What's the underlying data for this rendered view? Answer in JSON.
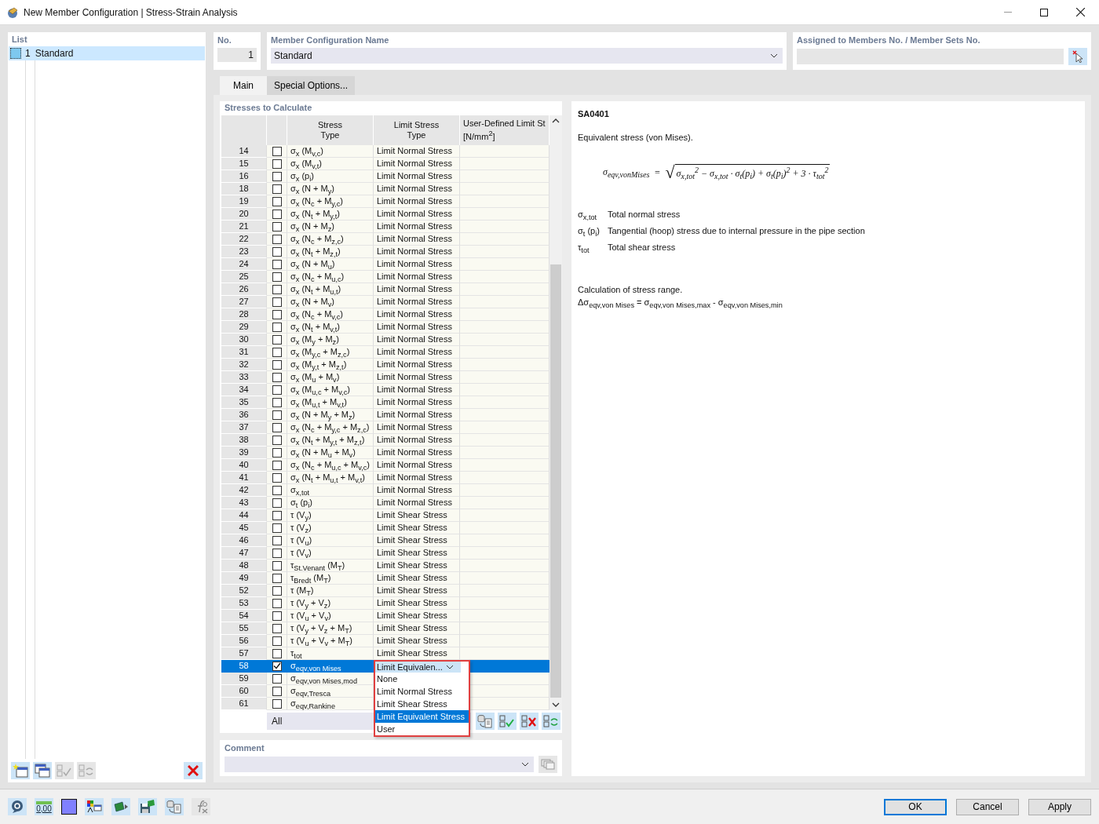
{
  "window": {
    "title": "New Member Configuration | Stress-Strain Analysis"
  },
  "list": {
    "heading": "List",
    "items": [
      {
        "no": "1",
        "name": "Standard",
        "selected": true
      }
    ]
  },
  "number": {
    "label": "No.",
    "value": "1"
  },
  "name": {
    "label": "Member Configuration Name",
    "value": "Standard"
  },
  "assigned": {
    "label": "Assigned to Members No. / Member Sets No."
  },
  "tabs": [
    {
      "label": "Main",
      "selected": true
    },
    {
      "label": "Special Options...",
      "selected": false
    }
  ],
  "stresses": {
    "heading": "Stresses to Calculate",
    "columns": [
      [
        "Stress",
        "Type"
      ],
      [
        "Limit Stress",
        "Type"
      ],
      [
        "User-Defined Limit St",
        "[N/mm$^{2}$]"
      ]
    ],
    "rows": [
      {
        "no": "14",
        "checked": false,
        "selected": false,
        "stress": "σ$_{x}$ (M$_{v,c}$)",
        "limit": "Limit Normal Stress"
      },
      {
        "no": "15",
        "checked": false,
        "selected": false,
        "stress": "σ$_{x}$ (M$_{v,t}$)",
        "limit": "Limit Normal Stress"
      },
      {
        "no": "16",
        "checked": false,
        "selected": false,
        "stress": "σ$_{x}$ (p$_{i}$)",
        "limit": "Limit Normal Stress"
      },
      {
        "no": "18",
        "checked": false,
        "selected": false,
        "stress": "σ$_{x}$ (N + M$_{y}$)",
        "limit": "Limit Normal Stress"
      },
      {
        "no": "19",
        "checked": false,
        "selected": false,
        "stress": "σ$_{x}$ (N$_{c}$ + M$_{y,c}$)",
        "limit": "Limit Normal Stress"
      },
      {
        "no": "20",
        "checked": false,
        "selected": false,
        "stress": "σ$_{x}$ (N$_{t}$ + M$_{y,t}$)",
        "limit": "Limit Normal Stress"
      },
      {
        "no": "21",
        "checked": false,
        "selected": false,
        "stress": "σ$_{x}$ (N + M$_{z}$)",
        "limit": "Limit Normal Stress"
      },
      {
        "no": "22",
        "checked": false,
        "selected": false,
        "stress": "σ$_{x}$ (N$_{c}$ + M$_{z,c}$)",
        "limit": "Limit Normal Stress"
      },
      {
        "no": "23",
        "checked": false,
        "selected": false,
        "stress": "σ$_{x}$ (N$_{t}$ + M$_{z,t}$)",
        "limit": "Limit Normal Stress"
      },
      {
        "no": "24",
        "checked": false,
        "selected": false,
        "stress": "σ$_{x}$ (N + M$_{u}$)",
        "limit": "Limit Normal Stress"
      },
      {
        "no": "25",
        "checked": false,
        "selected": false,
        "stress": "σ$_{x}$ (N$_{c}$ + M$_{u,c}$)",
        "limit": "Limit Normal Stress"
      },
      {
        "no": "26",
        "checked": false,
        "selected": false,
        "stress": "σ$_{x}$ (N$_{t}$ + M$_{u,t}$)",
        "limit": "Limit Normal Stress"
      },
      {
        "no": "27",
        "checked": false,
        "selected": false,
        "stress": "σ$_{x}$ (N + M$_{v}$)",
        "limit": "Limit Normal Stress"
      },
      {
        "no": "28",
        "checked": false,
        "selected": false,
        "stress": "σ$_{x}$ (N$_{c}$ + M$_{v,c}$)",
        "limit": "Limit Normal Stress"
      },
      {
        "no": "29",
        "checked": false,
        "selected": false,
        "stress": "σ$_{x}$ (N$_{t}$ + M$_{v,t}$)",
        "limit": "Limit Normal Stress"
      },
      {
        "no": "30",
        "checked": false,
        "selected": false,
        "stress": "σ$_{x}$ (M$_{y}$ + M$_{z}$)",
        "limit": "Limit Normal Stress"
      },
      {
        "no": "31",
        "checked": false,
        "selected": false,
        "stress": "σ$_{x}$ (M$_{y,c}$ + M$_{z,c}$)",
        "limit": "Limit Normal Stress"
      },
      {
        "no": "32",
        "checked": false,
        "selected": false,
        "stress": "σ$_{x}$ (M$_{y,t}$ + M$_{z,t}$)",
        "limit": "Limit Normal Stress"
      },
      {
        "no": "33",
        "checked": false,
        "selected": false,
        "stress": "σ$_{x}$ (M$_{u}$ + M$_{v}$)",
        "limit": "Limit Normal Stress"
      },
      {
        "no": "34",
        "checked": false,
        "selected": false,
        "stress": "σ$_{x}$ (M$_{u,c}$ + M$_{v,c}$)",
        "limit": "Limit Normal Stress"
      },
      {
        "no": "35",
        "checked": false,
        "selected": false,
        "stress": "σ$_{x}$ (M$_{u,t}$ + M$_{v,t}$)",
        "limit": "Limit Normal Stress"
      },
      {
        "no": "36",
        "checked": false,
        "selected": false,
        "stress": "σ$_{x}$ (N + M$_{y}$ + M$_{z}$)",
        "limit": "Limit Normal Stress"
      },
      {
        "no": "37",
        "checked": false,
        "selected": false,
        "stress": "σ$_{x}$ (N$_{c}$ + M$_{y,c}$ + M$_{z,c}$)",
        "limit": "Limit Normal Stress"
      },
      {
        "no": "38",
        "checked": false,
        "selected": false,
        "stress": "σ$_{x}$ (N$_{t}$ + M$_{y,t}$ + M$_{z,t}$)",
        "limit": "Limit Normal Stress"
      },
      {
        "no": "39",
        "checked": false,
        "selected": false,
        "stress": "σ$_{x}$ (N + M$_{u}$ + M$_{v}$)",
        "limit": "Limit Normal Stress"
      },
      {
        "no": "40",
        "checked": false,
        "selected": false,
        "stress": "σ$_{x}$ (N$_{c}$ + M$_{u,c}$ + M$_{v,c}$)",
        "limit": "Limit Normal Stress"
      },
      {
        "no": "41",
        "checked": false,
        "selected": false,
        "stress": "σ$_{x}$ (N$_{t}$ + M$_{u,t}$ + M$_{v,t}$)",
        "limit": "Limit Normal Stress"
      },
      {
        "no": "42",
        "checked": false,
        "selected": false,
        "stress": "σ$_{x,tot}$",
        "limit": "Limit Normal Stress"
      },
      {
        "no": "43",
        "checked": false,
        "selected": false,
        "stress": "σ$_{t}$ (p$_{i}$)",
        "limit": "Limit Normal Stress"
      },
      {
        "no": "44",
        "checked": false,
        "selected": false,
        "stress": "τ (V$_{y}$)",
        "limit": "Limit Shear Stress"
      },
      {
        "no": "45",
        "checked": false,
        "selected": false,
        "stress": "τ (V$_{z}$)",
        "limit": "Limit Shear Stress"
      },
      {
        "no": "46",
        "checked": false,
        "selected": false,
        "stress": "τ (V$_{u}$)",
        "limit": "Limit Shear Stress"
      },
      {
        "no": "47",
        "checked": false,
        "selected": false,
        "stress": "τ (V$_{v}$)",
        "limit": "Limit Shear Stress"
      },
      {
        "no": "48",
        "checked": false,
        "selected": false,
        "stress": "τ$_{St.Venant}$ (M$_{T}$)",
        "limit": "Limit Shear Stress"
      },
      {
        "no": "49",
        "checked": false,
        "selected": false,
        "stress": "τ$_{Bredt}$ (M$_{T}$)",
        "limit": "Limit Shear Stress"
      },
      {
        "no": "52",
        "checked": false,
        "selected": false,
        "stress": "τ (M$_{T}$)",
        "limit": "Limit Shear Stress"
      },
      {
        "no": "53",
        "checked": false,
        "selected": false,
        "stress": "τ (V$_{y}$ + V$_{z}$)",
        "limit": "Limit Shear Stress"
      },
      {
        "no": "54",
        "checked": false,
        "selected": false,
        "stress": "τ (V$_{u}$ + V$_{v}$)",
        "limit": "Limit Shear Stress"
      },
      {
        "no": "55",
        "checked": false,
        "selected": false,
        "stress": "τ (V$_{y}$ + V$_{z}$ + M$_{T}$)",
        "limit": "Limit Shear Stress"
      },
      {
        "no": "56",
        "checked": false,
        "selected": false,
        "stress": "τ (V$_{u}$ + V$_{v}$ + M$_{T}$)",
        "limit": "Limit Shear Stress"
      },
      {
        "no": "57",
        "checked": false,
        "selected": false,
        "stress": "τ$_{tot}$",
        "limit": "Limit Shear Stress"
      },
      {
        "no": "58",
        "checked": true,
        "selected": true,
        "stress": "σ$_{eqv,von Mises}$",
        "limit": "Limit Equivalen..."
      },
      {
        "no": "59",
        "checked": false,
        "selected": false,
        "stress": "σ$_{eqv,von Mises,mod}$"
      },
      {
        "no": "60",
        "checked": false,
        "selected": false,
        "stress": "σ$_{eqv,Tresca}$"
      },
      {
        "no": "61",
        "checked": false,
        "selected": false,
        "stress": "σ$_{eqv,Rankine}$"
      }
    ],
    "options": [
      {
        "label": "None",
        "selected": false
      },
      {
        "label": "Limit Normal Stress",
        "selected": false
      },
      {
        "label": "Limit Shear Stress",
        "selected": false
      },
      {
        "label": "Limit Equivalent Stress",
        "selected": true
      },
      {
        "label": "User",
        "selected": false
      }
    ],
    "filter": "All"
  },
  "comment": {
    "label": "Comment"
  },
  "description": {
    "code": "SA0401",
    "text": "Equivalent stress (von Mises).",
    "formula": {
      "lhs": "σ$_{eqv,vonMises}$",
      "equals": "=",
      "radical": "√",
      "radicand": "σ$_{x,tot}$$^{2}$ − σ$_{x,tot}$ · σ$_{t}$(p$_{i}$) + σ$_{t}$(p$_{i}$)$^{2}$ + 3 · τ$_{tot}$$^{2}$"
    },
    "symbols": [
      {
        "symbol": "σ$_{x,tot}$",
        "meaning": "Total normal stress"
      },
      {
        "symbol": "σ$_{t}$ (p$_{i}$)",
        "meaning": "Tangential (hoop) stress due to internal pressure in the pipe section"
      },
      {
        "symbol": "τ$_{tot}$",
        "meaning": "Total shear stress"
      }
    ],
    "range_title": "Calculation of stress range.",
    "range_formula": "Δσ$_{eqv,von Mises}$ = σ$_{eqv,von Mises,max}$ - σ$_{eqv,von Mises,min}$"
  },
  "units_value": "0,00",
  "buttons": [
    {
      "label": "OK",
      "focused": true
    },
    {
      "label": "Cancel",
      "focused": false
    },
    {
      "label": "Apply",
      "focused": false
    }
  ]
}
